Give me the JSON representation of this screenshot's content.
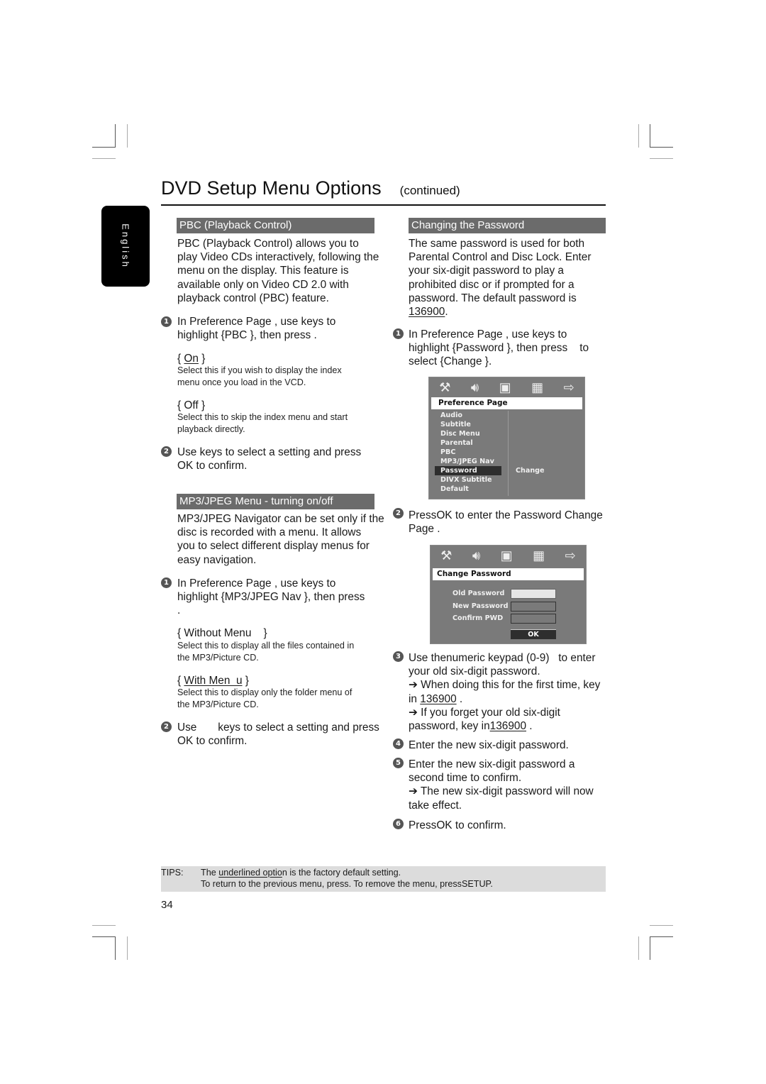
{
  "header": {
    "title": "DVD Setup Menu Options",
    "subtitle": "(continued)",
    "language_tab": "English"
  },
  "left": {
    "pbc": {
      "heading": "PBC (Playback Control)",
      "intro": [
        "PBC (Playback Control) allows you to",
        "play Video CDs interactively, following the",
        "menu on the display. This feature is",
        "available only on  Video CD 2.0 with",
        "playback control (PBC) feature."
      ],
      "step1": {
        "num": "1",
        "lines": [
          "In  Preference Page , use  keys to",
          "highlight {PBC }, then press  ."
        ]
      },
      "options": [
        {
          "pre": "{ ",
          "label": "On",
          "post": " }",
          "default": true,
          "desc": [
            "Select this if you wish to display the index",
            "menu once you load in the VCD."
          ]
        },
        {
          "pre": "{ ",
          "label": "Off",
          "post": "  }",
          "default": false,
          "desc": [
            "Select this to skip the index menu and start",
            "playback directly."
          ]
        }
      ],
      "step2": {
        "num": "2",
        "lines": [
          "Use       keys to select a setting and press",
          "OK  to confirm."
        ]
      }
    },
    "mp3": {
      "heading": "MP3/JPEG Menu - turning on/off",
      "intro": [
        "MP3/JPEG Navigator can be set only if the",
        "disc is recorded with a menu.  It allows",
        "you to select different display menus for",
        "easy navigation."
      ],
      "step1": {
        "num": "1",
        "lines": [
          "In  Preference Page , use  keys to",
          "highlight {MP3/JPEG Nav }, then press",
          "  ."
        ]
      },
      "options": [
        {
          "pre": "{ ",
          "label": "Without Menu",
          "post": "    }",
          "default": false,
          "desc": [
            "Select this to display all the files contained in",
            "the MP3/Picture CD."
          ]
        },
        {
          "pre": "{ ",
          "label": "With Men  u",
          "post": " }",
          "default": true,
          "desc": [
            "Select this to display only the folder menu of",
            "the MP3/Picture CD."
          ]
        }
      ],
      "step2": {
        "num": "2",
        "lines": [
          "Use       keys to select a setting and press",
          "OK  to confirm."
        ]
      }
    }
  },
  "right": {
    "heading": "Changing the Password",
    "intro": [
      "The same password is used for both",
      "Parental Control and Disc Lock.  Enter",
      "your six-digit password to play a",
      "prohibited disc or if prompted for a",
      "password. The default password is"
    ],
    "intro_default": "136900",
    "intro_tail": ".",
    "step1": {
      "num": "1",
      "lines": [
        "In  Preference Page , use  keys to",
        "highlight {Password }, then press    to",
        "select {Change }."
      ]
    },
    "osd_icons": [
      "wrench-screwdriver-icon",
      "speaker-icon",
      "film-icon",
      "checkerboard-icon",
      "exit-icon"
    ],
    "osd1": {
      "title": "Preference Page",
      "items": [
        "Audio",
        "Subtitle",
        "Disc Menu",
        "Parental",
        "PBC",
        "MP3/JPEG Nav",
        "Password",
        "DIVX Subtitle",
        "Default"
      ],
      "selected": "Password",
      "value": "Change"
    },
    "step2": {
      "num": "2",
      "lines": [
        "PressOK  to enter the  Password Change",
        "Page ."
      ]
    },
    "osd2": {
      "title": "Change Password",
      "fields": [
        "Old Password",
        "New Password",
        "Confirm PWD"
      ],
      "ok": "OK"
    },
    "step3": {
      "num": "3",
      "lines": [
        "Use thenumeric keypad (0-9)   to enter",
        "your old six-digit password."
      ],
      "note1_a": "➔ When doing this for the first time, key",
      "note1_b": "in ",
      "note1_code": "136900",
      "note1_c": " .",
      "note2_a": "➔ If you forget your old six-digit",
      "note2_b": "password, key in",
      "note2_code": "136900",
      "note2_c": " ."
    },
    "step4": {
      "num": "4",
      "lines": [
        "Enter the new six-digit password."
      ]
    },
    "step5": {
      "num": "5",
      "lines": [
        "Enter the new six-digit password a",
        "second time to confirm."
      ],
      "note": [
        "➔ The new six-digit password will now",
        "take effect."
      ]
    },
    "step6": {
      "num": "6",
      "lines": [
        "PressOK  to confirm."
      ]
    }
  },
  "tips": {
    "label": "TIPS:",
    "line1_pre": "The ",
    "line1_u": "underlined optio",
    "line1_post": "n is the factory default setting.",
    "line2": "To return to the previous menu, press.  To remove the menu, pressSETUP."
  },
  "page_number": "34"
}
